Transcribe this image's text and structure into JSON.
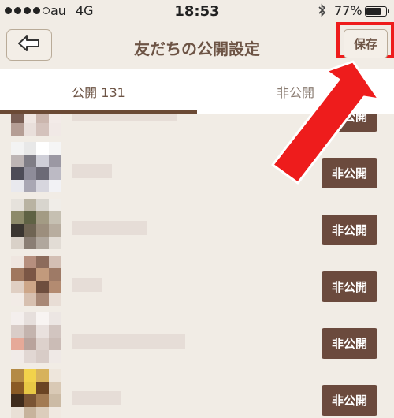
{
  "status_bar": {
    "carrier": "au",
    "network": "4G",
    "time": "18:53",
    "bluetooth_icon": "bluetooth-icon",
    "battery_percent": "77%",
    "battery_level": 0.77
  },
  "nav": {
    "back_icon": "left-arrow-icon",
    "title": "友だちの公開設定",
    "save_label": "保存"
  },
  "tabs": [
    {
      "label": "公開 131",
      "active": true
    },
    {
      "label": "非公開",
      "active": false
    }
  ],
  "rows": [
    {
      "button_label": "非公開"
    },
    {
      "button_label": "非公開"
    },
    {
      "button_label": "非公開"
    },
    {
      "button_label": "非公開"
    },
    {
      "button_label": "非公開"
    },
    {
      "button_label": "非公開"
    }
  ],
  "colors": {
    "accent_brown": "#6b4a3d",
    "title_brown": "#6d5445",
    "background": "#f1ece5",
    "annotation_red": "#ee1c1c"
  }
}
